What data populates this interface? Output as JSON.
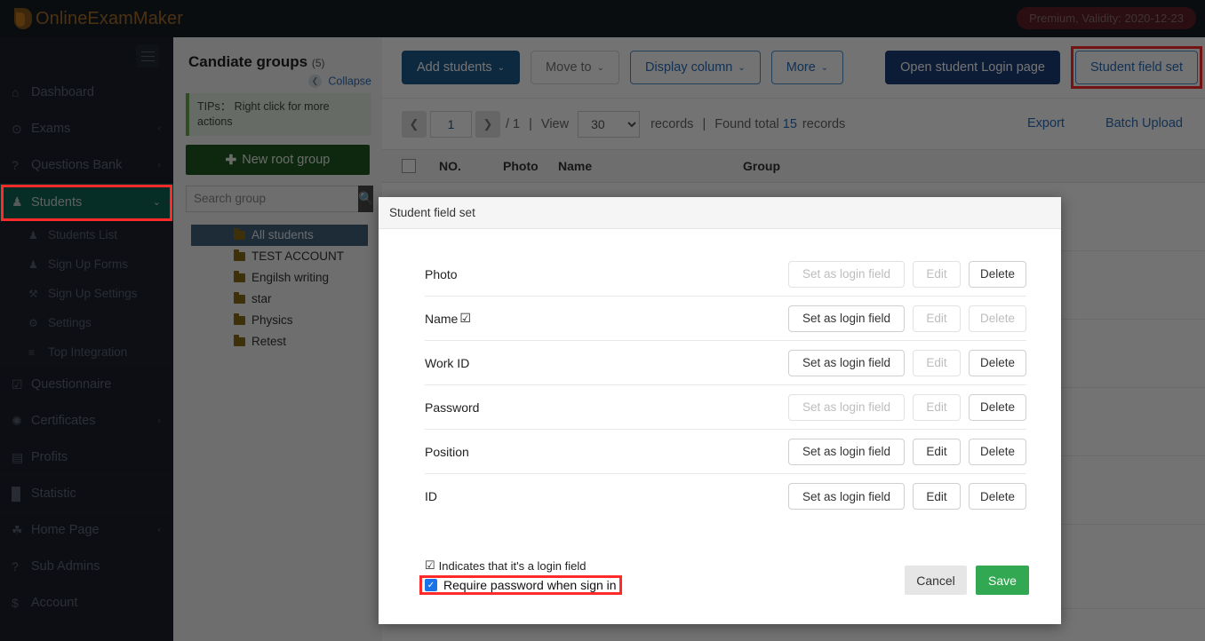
{
  "topbar": {
    "brand": "OnlineExamMaker",
    "premium_badge": "Premium, Validity: 2020-12-23"
  },
  "sidebar": {
    "items": [
      {
        "label": "Dashboard",
        "icon": "home-icon",
        "glyph": "⌂",
        "caret": "",
        "active": false
      },
      {
        "label": "Exams",
        "icon": "check-circle-icon",
        "glyph": "⊙",
        "caret": "‹",
        "active": false
      },
      {
        "label": "Questions Bank",
        "icon": "question-icon",
        "glyph": "?",
        "caret": "‹",
        "active": false
      },
      {
        "label": "Students",
        "icon": "users-icon",
        "glyph": "♟",
        "caret": "⌄",
        "active": true
      }
    ],
    "sub_items": [
      {
        "label": "Students List",
        "icon": "user-list-icon",
        "glyph": "♟"
      },
      {
        "label": "Sign Up Forms",
        "icon": "user-plus-icon",
        "glyph": "♟"
      },
      {
        "label": "Sign Up Settings",
        "icon": "wrench-icon",
        "glyph": "⚒"
      },
      {
        "label": "Settings",
        "icon": "gear-icon",
        "glyph": "⚙"
      },
      {
        "label": "Top Integration",
        "icon": "list-icon",
        "glyph": "≡"
      }
    ],
    "items_lower": [
      {
        "label": "Questionnaire",
        "icon": "checkbox-icon",
        "glyph": "☑",
        "caret": ""
      },
      {
        "label": "Certificates",
        "icon": "badge-icon",
        "glyph": "✺",
        "caret": "‹"
      },
      {
        "label": "Profits",
        "icon": "card-icon",
        "glyph": "▤",
        "caret": ""
      },
      {
        "label": "Statistic",
        "icon": "bar-chart-icon",
        "glyph": "█",
        "caret": ""
      },
      {
        "label": "Home Page",
        "icon": "leaf-icon",
        "glyph": "☘",
        "caret": "‹"
      },
      {
        "label": "Sub Admins",
        "icon": "question-icon",
        "glyph": "?",
        "caret": ""
      },
      {
        "label": "Account",
        "icon": "dollar-icon",
        "glyph": "$",
        "caret": ""
      }
    ],
    "menu_toggle": "hamburger-icon"
  },
  "groups": {
    "title": "Candiate groups",
    "count": "(5)",
    "collapse_label": "Collapse",
    "collapse_icon": "chevron-left-icon",
    "tips": "TIPs： Right click for more actions",
    "new_root_label": "New root group",
    "search_placeholder": "Search group",
    "search_value": "",
    "search_icon": "search-icon",
    "tree": [
      {
        "label": "All students",
        "selected": true
      },
      {
        "label": "TEST ACCOUNT",
        "selected": false
      },
      {
        "label": "Engilsh writing",
        "selected": false
      },
      {
        "label": "star",
        "selected": false
      },
      {
        "label": "Physics",
        "selected": false
      },
      {
        "label": "Retest",
        "selected": false
      }
    ]
  },
  "toolbar": {
    "add_students": "Add students",
    "move_to": "Move to",
    "display_column": "Display column",
    "more": "More",
    "open_student_login": "Open student Login page",
    "student_field_set": "Student field set",
    "caret_glyph": "⌄"
  },
  "pager": {
    "prev_icon": "chevron-left-icon",
    "next_icon": "chevron-right-icon",
    "page_value": "1",
    "of_pages": "/ 1",
    "divider": "|",
    "view_label": "View",
    "page_size": "30",
    "page_size_options": [
      "30"
    ],
    "records_label": "records",
    "divider2": "|",
    "found_prefix": "Found total",
    "found_count": "15",
    "found_suffix": "records",
    "export": "Export",
    "batch_upload": "Batch Upload"
  },
  "table": {
    "headers": [
      "NO.",
      "Photo",
      "Name",
      "Group"
    ],
    "select_all_icon": "checkbox-icon"
  },
  "modal": {
    "title": "Student field set",
    "rows": [
      {
        "name": "Photo",
        "is_login_field": false,
        "set_login": "Set as login field",
        "set_login_disabled": true,
        "edit": "Edit",
        "edit_disabled": true,
        "delete": "Delete",
        "delete_disabled": false
      },
      {
        "name": "Name",
        "is_login_field": true,
        "set_login": "Set as login field",
        "set_login_disabled": false,
        "edit": "Edit",
        "edit_disabled": true,
        "delete": "Delete",
        "delete_disabled": true
      },
      {
        "name": "Work ID",
        "is_login_field": false,
        "set_login": "Set as login field",
        "set_login_disabled": false,
        "edit": "Edit",
        "edit_disabled": true,
        "delete": "Delete",
        "delete_disabled": false
      },
      {
        "name": "Password",
        "is_login_field": false,
        "set_login": "Set as login field",
        "set_login_disabled": true,
        "edit": "Edit",
        "edit_disabled": true,
        "delete": "Delete",
        "delete_disabled": false
      },
      {
        "name": "Position",
        "is_login_field": false,
        "set_login": "Set as login field",
        "set_login_disabled": false,
        "edit": "Edit",
        "edit_disabled": false,
        "delete": "Delete",
        "delete_disabled": false
      },
      {
        "name": "ID",
        "is_login_field": false,
        "set_login": "Set as login field",
        "set_login_disabled": false,
        "edit": "Edit",
        "edit_disabled": false,
        "delete": "Delete",
        "delete_disabled": false
      }
    ],
    "login_mark_glyph": "☑",
    "legend": "Indicates that it's a login field",
    "require_password": "Require password when sign in",
    "require_password_checked": true,
    "check_glyph": "✓",
    "cancel": "Cancel",
    "save": "Save"
  },
  "colors": {
    "brand": "#a9702c",
    "sidebar_bg": "#1b212b",
    "active_nav": "#0f6655",
    "primary_btn": "#1c5b8e",
    "darkblue_btn": "#1b3f7a",
    "link_blue": "#2a6ebb",
    "save_green": "#32a852",
    "new_group_green": "#1d5a22",
    "highlight_red": "#ff2a2a",
    "premium_badge": "#5d2127",
    "checkbox_blue": "#1a73e8"
  }
}
